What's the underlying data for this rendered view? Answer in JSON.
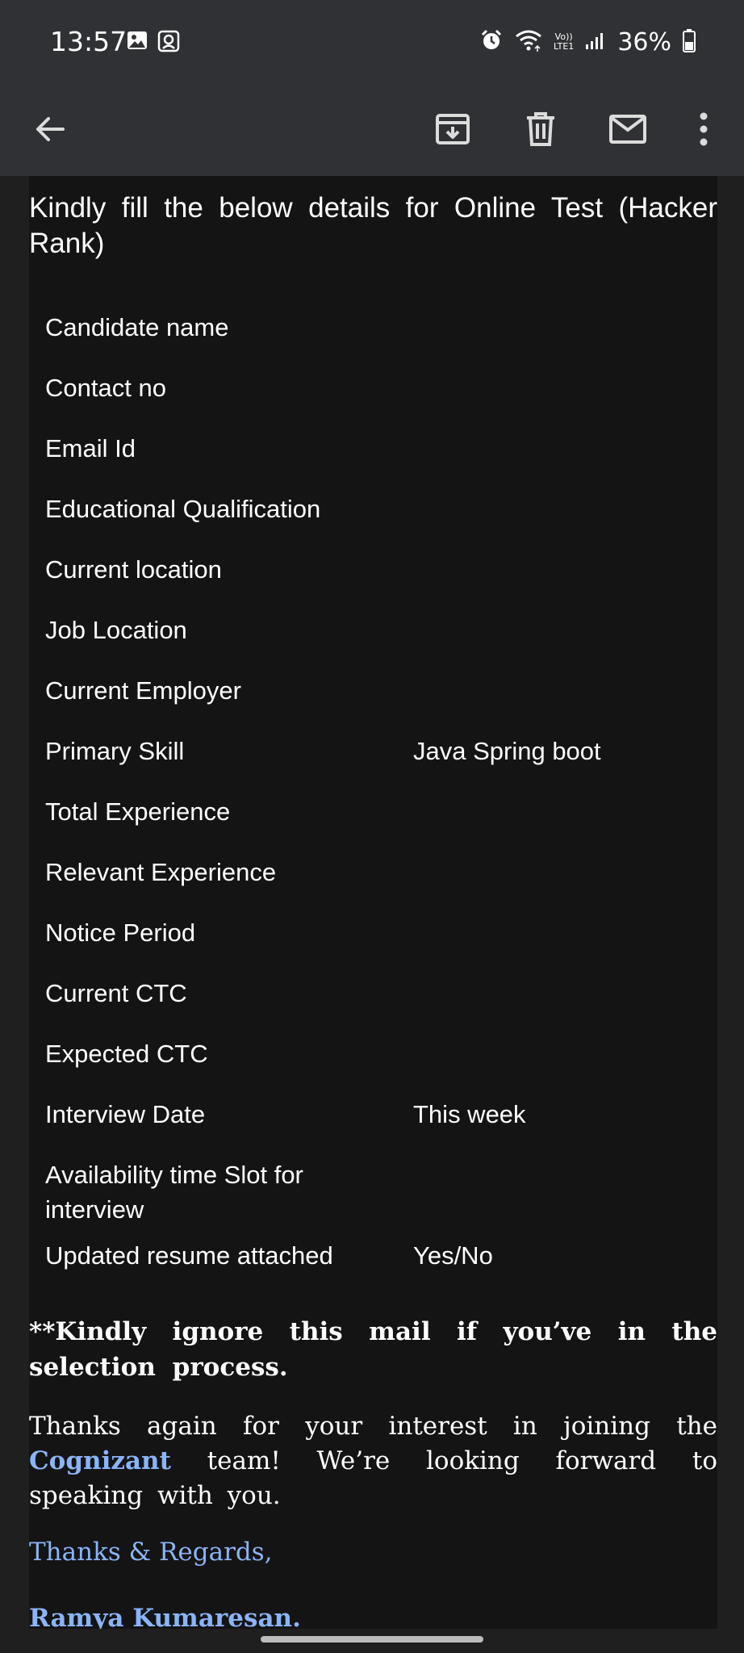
{
  "status_bar": {
    "time": "13:57",
    "lte_top": "Vo))",
    "lte_bottom": "LTE1",
    "battery": "36%",
    "icons": [
      "gallery-icon",
      "screenshot-icon",
      "alarm-icon",
      "wifi-icon",
      "signal-icon",
      "battery-icon"
    ]
  },
  "toolbar": {
    "icons": [
      "back-arrow-icon",
      "archive-icon",
      "delete-icon",
      "mark-unread-icon",
      "more-options-icon"
    ]
  },
  "email": {
    "intro": "Kindly fill the below details for Online Test (Hacker Rank)",
    "rows": [
      {
        "label": "Candidate name",
        "value": ""
      },
      {
        "label": "Contact no",
        "value": ""
      },
      {
        "label": "Email Id",
        "value": ""
      },
      {
        "label": "Educational Qualification",
        "value": ""
      },
      {
        "label": "Current location",
        "value": ""
      },
      {
        "label": "Job Location",
        "value": ""
      },
      {
        "label": "Current Employer",
        "value": ""
      },
      {
        "label": "Primary Skill",
        "value": "Java Spring boot"
      },
      {
        "label": "Total Experience",
        "value": ""
      },
      {
        "label": "Relevant Experience",
        "value": ""
      },
      {
        "label": "Notice Period",
        "value": ""
      },
      {
        "label": "Current CTC",
        "value": ""
      },
      {
        "label": "Expected CTC",
        "value": ""
      },
      {
        "label": "Interview Date",
        "value": "This week"
      },
      {
        "label": "Availability time Slot for interview",
        "value": ""
      },
      {
        "label": "Updated resume attached",
        "value": "Yes/No"
      }
    ],
    "note": "**Kindly ignore this mail if you’ve in the selection process.",
    "thanks_before": "Thanks again for your interest in joining the",
    "thanks_brand": "Cognizant",
    "thanks_after": "team! We’re looking forward to speaking with you.",
    "regards": "Thanks & Regards,",
    "signature": "Ramya Kumaresan."
  },
  "colors": {
    "bar_bg": "#303134",
    "content_bg": "#141414",
    "link_blue": "#8ab4f8"
  }
}
